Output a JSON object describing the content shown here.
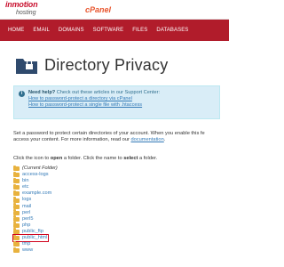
{
  "brand": {
    "host_name": "inmotion",
    "host_sub": "hosting",
    "panel_name": "cPanel"
  },
  "nav": {
    "items": [
      "HOME",
      "EMAIL",
      "DOMAINS",
      "SOFTWARE",
      "FILES",
      "DATABASES"
    ]
  },
  "page": {
    "title": "Directory Privacy"
  },
  "help": {
    "heading_bold": "Need help?",
    "heading_text": " Check out these articles in our Support Center:",
    "links": [
      "How to password-protect a directory via cPanel",
      "How to password-protect a single file with .htaccess"
    ]
  },
  "description": {
    "line1": "Set a password to protect certain directories of your account. When you enable this fe",
    "line2_prefix": "access your content. For more information, read our ",
    "line2_link": "documentation",
    "line2_suffix": "."
  },
  "instructions": {
    "p1": "Click the icon to ",
    "b1": "open",
    "p2": " a folder. Click the name to ",
    "b2": "select",
    "p3": " a folder."
  },
  "tree": {
    "current": "(Current Folder)",
    "folders": [
      "access-logs",
      "bin",
      "etc",
      "example.com",
      "logs",
      "mail",
      "perl",
      "perl5",
      "php",
      "public_ftp",
      "public_html",
      "tmp",
      "www"
    ],
    "highlighted": "public_html"
  },
  "colors": {
    "nav_bg": "#b11c2b",
    "link": "#337ab7",
    "folder": "#e8b23e",
    "help_bg": "#d9edf7"
  }
}
